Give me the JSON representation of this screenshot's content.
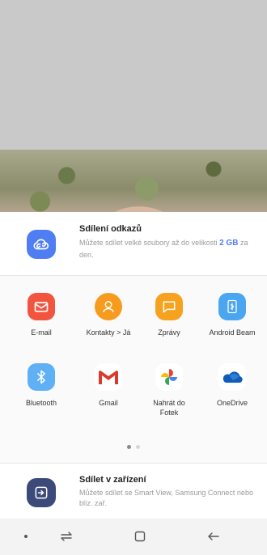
{
  "link_share": {
    "title": "Sdílení odkazů",
    "desc_prefix": "Můžete sdílet velké soubory až do velikosti ",
    "desc_highlight": "2 GB",
    "desc_suffix": " za den.",
    "icon": "cloud-link-icon",
    "color": "#4f7ef2"
  },
  "apps": [
    {
      "label": "E-mail",
      "icon": "email-icon",
      "color": "#f2553f"
    },
    {
      "label": "Kontakty > Já",
      "icon": "contact-icon",
      "color": "#f79b1f"
    },
    {
      "label": "Zprávy",
      "icon": "message-icon",
      "color": "#f7a21f"
    },
    {
      "label": "Android Beam",
      "icon": "nfc-icon",
      "color": "#4aa6f0"
    },
    {
      "label": "Bluetooth",
      "icon": "bluetooth-icon",
      "color": "#5fb0f5"
    },
    {
      "label": "Gmail",
      "icon": "gmail-icon",
      "color": "#ffffff"
    },
    {
      "label": "Nahrát do Fotek",
      "icon": "photos-icon",
      "color": "#ffffff"
    },
    {
      "label": "OneDrive",
      "icon": "onedrive-icon",
      "color": "#ffffff"
    }
  ],
  "pager": {
    "pages": 2,
    "current": 1
  },
  "device_share": {
    "title": "Sdílet v zařízení",
    "desc": "Můžete sdílet se Smart View, Samsung Connect nebo blíz. zař.",
    "icon": "device-share-icon",
    "color": "#3c4a7a"
  },
  "navbar": {
    "items": [
      "dot-icon",
      "recents-icon",
      "home-icon",
      "back-icon"
    ]
  }
}
